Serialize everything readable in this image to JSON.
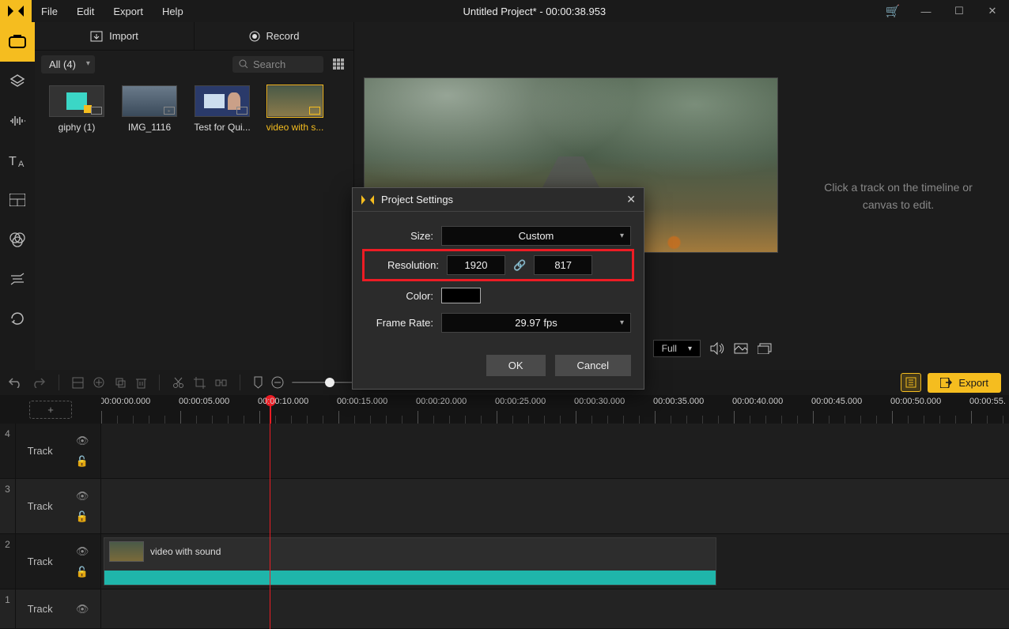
{
  "titlebar": {
    "title": "Untitled Project* - 00:00:38.953",
    "menus": [
      "File",
      "Edit",
      "Export",
      "Help"
    ]
  },
  "mediaPanel": {
    "importLabel": "Import",
    "recordLabel": "Record",
    "filterLabel": "All (4)",
    "searchPlaceholder": "Search",
    "items": [
      {
        "label": "giphy (1)"
      },
      {
        "label": "IMG_1116"
      },
      {
        "label": "Test for Qui..."
      },
      {
        "label": "video with s..."
      }
    ]
  },
  "sidePanel": {
    "message1": "Click a track on the timeline or",
    "message2": "canvas to edit."
  },
  "previewControls": {
    "full": "Full"
  },
  "exportBar": {
    "exportLabel": "Export"
  },
  "ruler": {
    "ticks": [
      "00:00:00.000",
      "00:00:05.000",
      "00:00:10.000",
      "00:00:15.000",
      "00:00:20.000",
      "00:00:25.000",
      "00:00:30.000",
      "00:00:35.000",
      "00:00:40.000",
      "00:00:45.000",
      "00:00:50.000",
      "00:00:55."
    ]
  },
  "tracks": [
    {
      "num": "4",
      "label": "Track"
    },
    {
      "num": "3",
      "label": "Track"
    },
    {
      "num": "2",
      "label": "Track",
      "clip": {
        "label": "video with sound"
      }
    },
    {
      "num": "1",
      "label": "Track"
    }
  ],
  "modal": {
    "title": "Project Settings",
    "sizeLabel": "Size:",
    "sizeValue": "Custom",
    "resLabel": "Resolution:",
    "resW": "1920",
    "resH": "817",
    "colorLabel": "Color:",
    "frLabel": "Frame Rate:",
    "frValue": "29.97 fps",
    "ok": "OK",
    "cancel": "Cancel"
  }
}
